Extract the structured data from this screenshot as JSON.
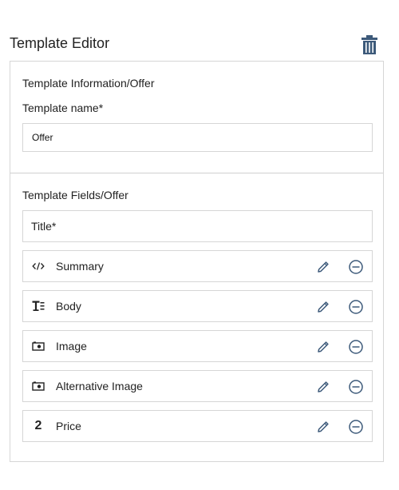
{
  "header": {
    "title": "Template Editor",
    "delete_icon": "trash-icon"
  },
  "info": {
    "section_label": "Template Information/Offer",
    "name_label": "Template name*",
    "name_value": "Offer"
  },
  "fields": {
    "section_label": "Template Fields/Offer",
    "title_field": "Title*",
    "items": [
      {
        "label": "Summary",
        "icon": "code-icon"
      },
      {
        "label": "Body",
        "icon": "text-format-icon"
      },
      {
        "label": "Image",
        "icon": "image-icon"
      },
      {
        "label": "Alternative Image",
        "icon": "image-icon"
      },
      {
        "label": "Price",
        "icon": "number-icon",
        "icon_text": "2"
      }
    ]
  },
  "colors": {
    "accent": "#3d5a7a",
    "border": "#d6d6d6",
    "text": "#222222"
  }
}
